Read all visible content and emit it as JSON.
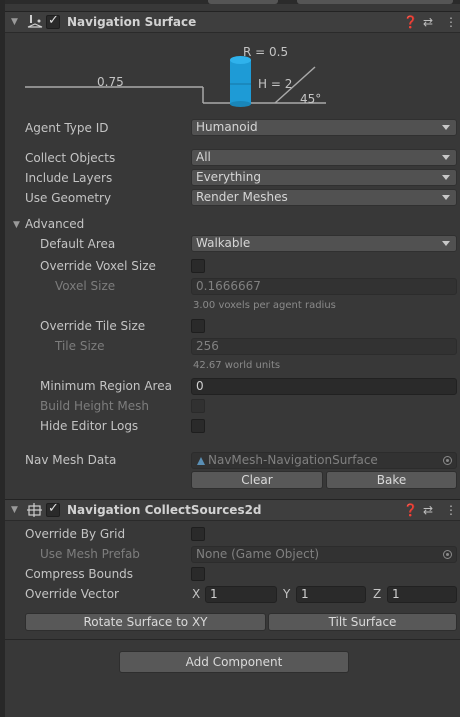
{
  "surface": {
    "title": "Navigation Surface",
    "diagram": {
      "radius_label": "R = 0.5",
      "height_label": "H = 2",
      "step_label": "0.75",
      "slope_label": "45°"
    },
    "agent_type_label": "Agent Type ID",
    "agent_type_value": "Humanoid",
    "collect_objects_label": "Collect Objects",
    "collect_objects_value": "All",
    "include_layers_label": "Include Layers",
    "include_layers_value": "Everything",
    "use_geometry_label": "Use Geometry",
    "use_geometry_value": "Render Meshes",
    "advanced_label": "Advanced",
    "default_area_label": "Default Area",
    "default_area_value": "Walkable",
    "override_voxel_label": "Override Voxel Size",
    "voxel_size_label": "Voxel Size",
    "voxel_size_value": "0.1666667",
    "voxel_hint": "3.00 voxels per agent radius",
    "override_tile_label": "Override Tile Size",
    "tile_size_label": "Tile Size",
    "tile_size_value": "256",
    "tile_hint": "42.67 world units",
    "min_region_label": "Minimum Region Area",
    "min_region_value": "0",
    "build_height_label": "Build Height Mesh",
    "hide_logs_label": "Hide Editor Logs",
    "navmesh_data_label": "Nav Mesh Data",
    "navmesh_data_value": "NavMesh-NavigationSurface",
    "clear_label": "Clear",
    "bake_label": "Bake"
  },
  "collect": {
    "title": "Navigation CollectSources2d",
    "override_grid_label": "Override By Grid",
    "use_mesh_prefab_label": "Use Mesh Prefab",
    "use_mesh_prefab_value": "None (Game Object)",
    "compress_bounds_label": "Compress Bounds",
    "override_vector_label": "Override Vector",
    "x_label": "X",
    "x_value": "1",
    "y_label": "Y",
    "y_value": "1",
    "z_label": "Z",
    "z_value": "1",
    "rotate_label": "Rotate Surface to XY",
    "tilt_label": "Tilt Surface"
  },
  "add_component_label": "Add Component",
  "icons": {
    "help": "help-icon",
    "presets": "presets-icon",
    "menu": "kebab-menu-icon"
  },
  "colors": {
    "cylinder": "#1e9bd6",
    "panel": "#383838",
    "header": "#3e3e3e"
  }
}
